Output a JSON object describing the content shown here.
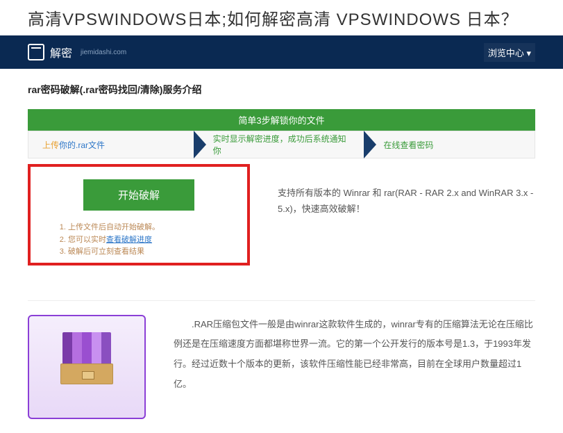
{
  "banner": {
    "title": "高清VPSWINDOWS日本;如何解密高清 VPSWINDOWS 日本？"
  },
  "nav": {
    "logo_text": "解密",
    "logo_sub": "jiemidashi.com",
    "right_item": "浏览中心",
    "right_chevron": "▾"
  },
  "page": {
    "title": "rar密码破解(.rar密码找回/清除)服务介绍"
  },
  "steps": {
    "header": "简单3步解锁你的文件",
    "step1_prefix": "上传",
    "step1_link": "你的.rar文件",
    "step2": "实时显示解密进度，成功后系统通知你",
    "step3": "在线查看密码"
  },
  "upload": {
    "start_button": "开始破解",
    "notes": {
      "n1": "上传文件后自动开始破解。",
      "n2_prefix": "您可以实时",
      "n2_link": "查看破解进度",
      "n3": "破解后可立刻查看结果"
    },
    "description": "支持所有版本的 Winrar 和 rar(RAR - RAR 2.x and WinRAR 3.x - 5.x)，快速高效破解！"
  },
  "info": {
    "paragraph": ".RAR压缩包文件一般是由winrar这款软件生成的，winrar专有的压缩算法无论在压缩比例还是在压缩速度方面都堪称世界一流。它的第一个公开发行的版本号是1.3，于1993年发行。经过近数十个版本的更新，该软件压缩性能已经非常高，目前在全球用户数量超过1亿。"
  }
}
